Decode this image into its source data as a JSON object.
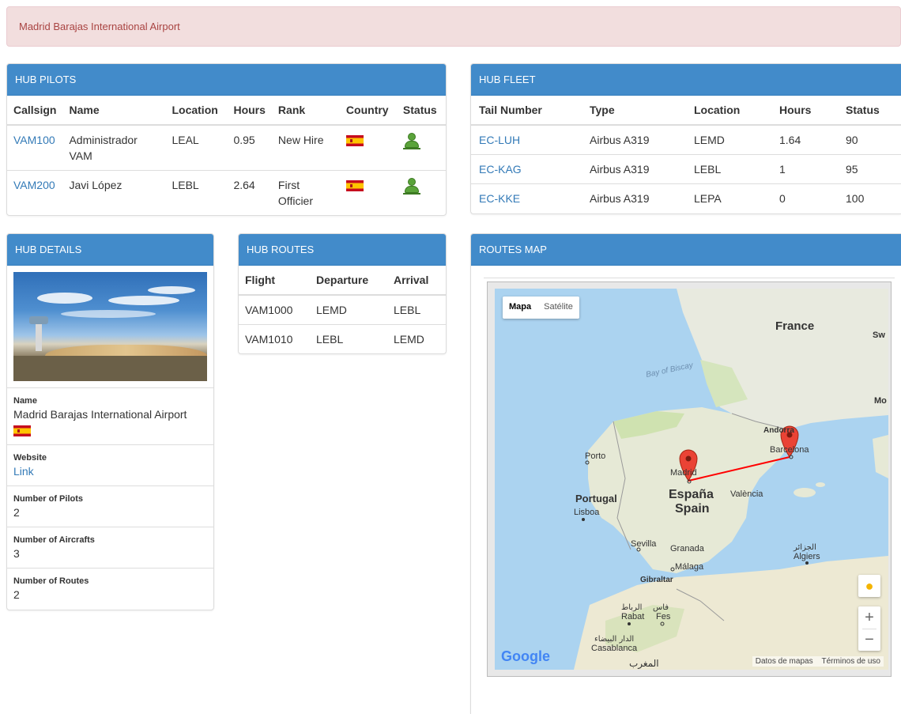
{
  "alert": {
    "text": "Madrid Barajas International Airport"
  },
  "hub_pilots": {
    "title": "HUB PILOTS",
    "columns": [
      "Callsign",
      "Name",
      "Location",
      "Hours",
      "Rank",
      "Country",
      "Status"
    ],
    "rows": [
      {
        "callsign": "VAM100",
        "name": "Administrador VAM",
        "location": "LEAL",
        "hours": "0.95",
        "rank": "New Hire",
        "country": "flag-spain-icon",
        "status": "user-active-icon"
      },
      {
        "callsign": "VAM200",
        "name": "Javi López",
        "location": "LEBL",
        "hours": "2.64",
        "rank": "First Officier",
        "country": "flag-spain-icon",
        "status": "user-active-icon"
      }
    ]
  },
  "hub_fleet": {
    "title": "HUB FLEET",
    "columns": [
      "Tail Number",
      "Type",
      "Location",
      "Hours",
      "Status"
    ],
    "rows": [
      {
        "tail": "EC-LUH",
        "type": "Airbus A319",
        "location": "LEMD",
        "hours": "1.64",
        "status": "90"
      },
      {
        "tail": "EC-KAG",
        "type": "Airbus A319",
        "location": "LEBL",
        "hours": "1",
        "status": "95"
      },
      {
        "tail": "EC-KKE",
        "type": "Airbus A319",
        "location": "LEPA",
        "hours": "0",
        "status": "100"
      }
    ]
  },
  "hub_details": {
    "title": "HUB DETAILS",
    "name_label": "Name",
    "name_value": "Madrid Barajas International Airport",
    "website_label": "Website",
    "website_value": "Link",
    "pilots_label": "Number of Pilots",
    "pilots_value": "2",
    "aircrafts_label": "Number of Aircrafts",
    "aircrafts_value": "3",
    "routes_label": "Number of Routes",
    "routes_value": "2"
  },
  "hub_routes": {
    "title": "HUB ROUTES",
    "columns": [
      "Flight",
      "Departure",
      "Arrival"
    ],
    "rows": [
      {
        "flight": "VAM1000",
        "departure": "LEMD",
        "arrival": "LEBL"
      },
      {
        "flight": "VAM1010",
        "departure": "LEBL",
        "arrival": "LEMD"
      }
    ]
  },
  "routes_map": {
    "title": "ROUTES MAP",
    "map_type_map": "Mapa",
    "map_type_satellite": "Satélite",
    "labels": {
      "france": "France",
      "bay": "Bay of Biscay",
      "porto": "Porto",
      "portugal": "Portugal",
      "lisboa": "Lisboa",
      "madrid": "Madrid",
      "espana": "España",
      "spain": "Spain",
      "valencia": "València",
      "andorra": "Andorra",
      "barcelona": "Barcelona",
      "sevilla": "Sevilla",
      "granada": "Granada",
      "malaga": "Málaga",
      "gibraltar": "Gibraltar",
      "algiers_ar": "الجزائر",
      "algiers": "Algiers",
      "rabat_ar": "الرباط",
      "rabat": "Rabat",
      "fes_ar": "فاس",
      "fes": "Fes",
      "casablanca_ar": "الدار البيضاء",
      "casablanca": "Casablanca",
      "maghreb_ar": "المغرب",
      "mo": "Mo",
      "sw": "Sw"
    },
    "zoom_in": "+",
    "zoom_out": "−",
    "google": "Google",
    "footer_data": "Datos de mapas",
    "footer_terms": "Términos de uso"
  }
}
